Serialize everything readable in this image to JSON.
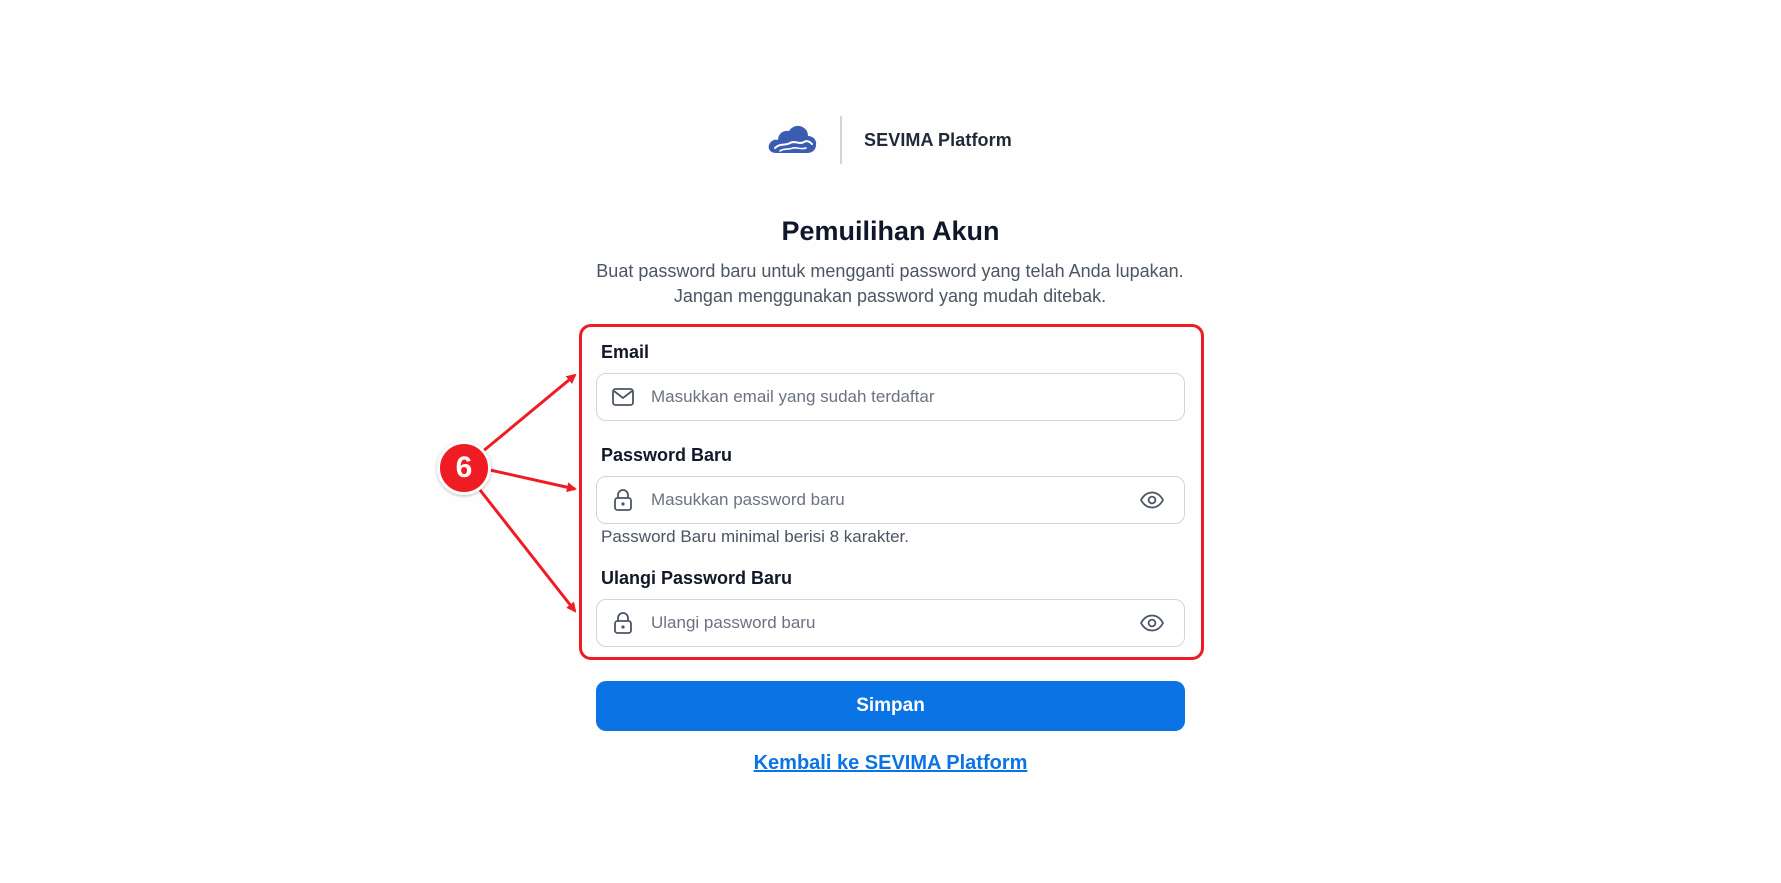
{
  "brand": {
    "name": "SEVIMA Platform",
    "logo_icon": "cloud-logo-icon",
    "logo_color": "#3b5db1"
  },
  "header": {
    "title": "Pemuilihan Akun",
    "subtitle": "Buat password baru untuk mengganti password yang telah Anda lupakan. Jangan menggunakan password yang mudah ditebak."
  },
  "form": {
    "email": {
      "label": "Email",
      "placeholder": "Masukkan email yang sudah terdaftar",
      "value": "",
      "icon": "mail-icon"
    },
    "new_password": {
      "label": "Password Baru",
      "placeholder": "Masukkan password baru",
      "value": "",
      "icon": "lock-icon",
      "toggle_icon": "eye-icon",
      "hint": "Password Baru minimal berisi 8 karakter."
    },
    "confirm_password": {
      "label": "Ulangi Password Baru",
      "placeholder": "Ulangi password baru",
      "value": "",
      "icon": "lock-icon",
      "toggle_icon": "eye-icon"
    },
    "submit_label": "Simpan"
  },
  "footer": {
    "back_link": "Kembali ke SEVIMA Platform"
  },
  "annotation": {
    "badge_number": "6",
    "color": "#ef1c24"
  },
  "colors": {
    "primary": "#0b74e5",
    "text": "#111827",
    "muted": "#4b5563",
    "border": "#d1d5db"
  }
}
